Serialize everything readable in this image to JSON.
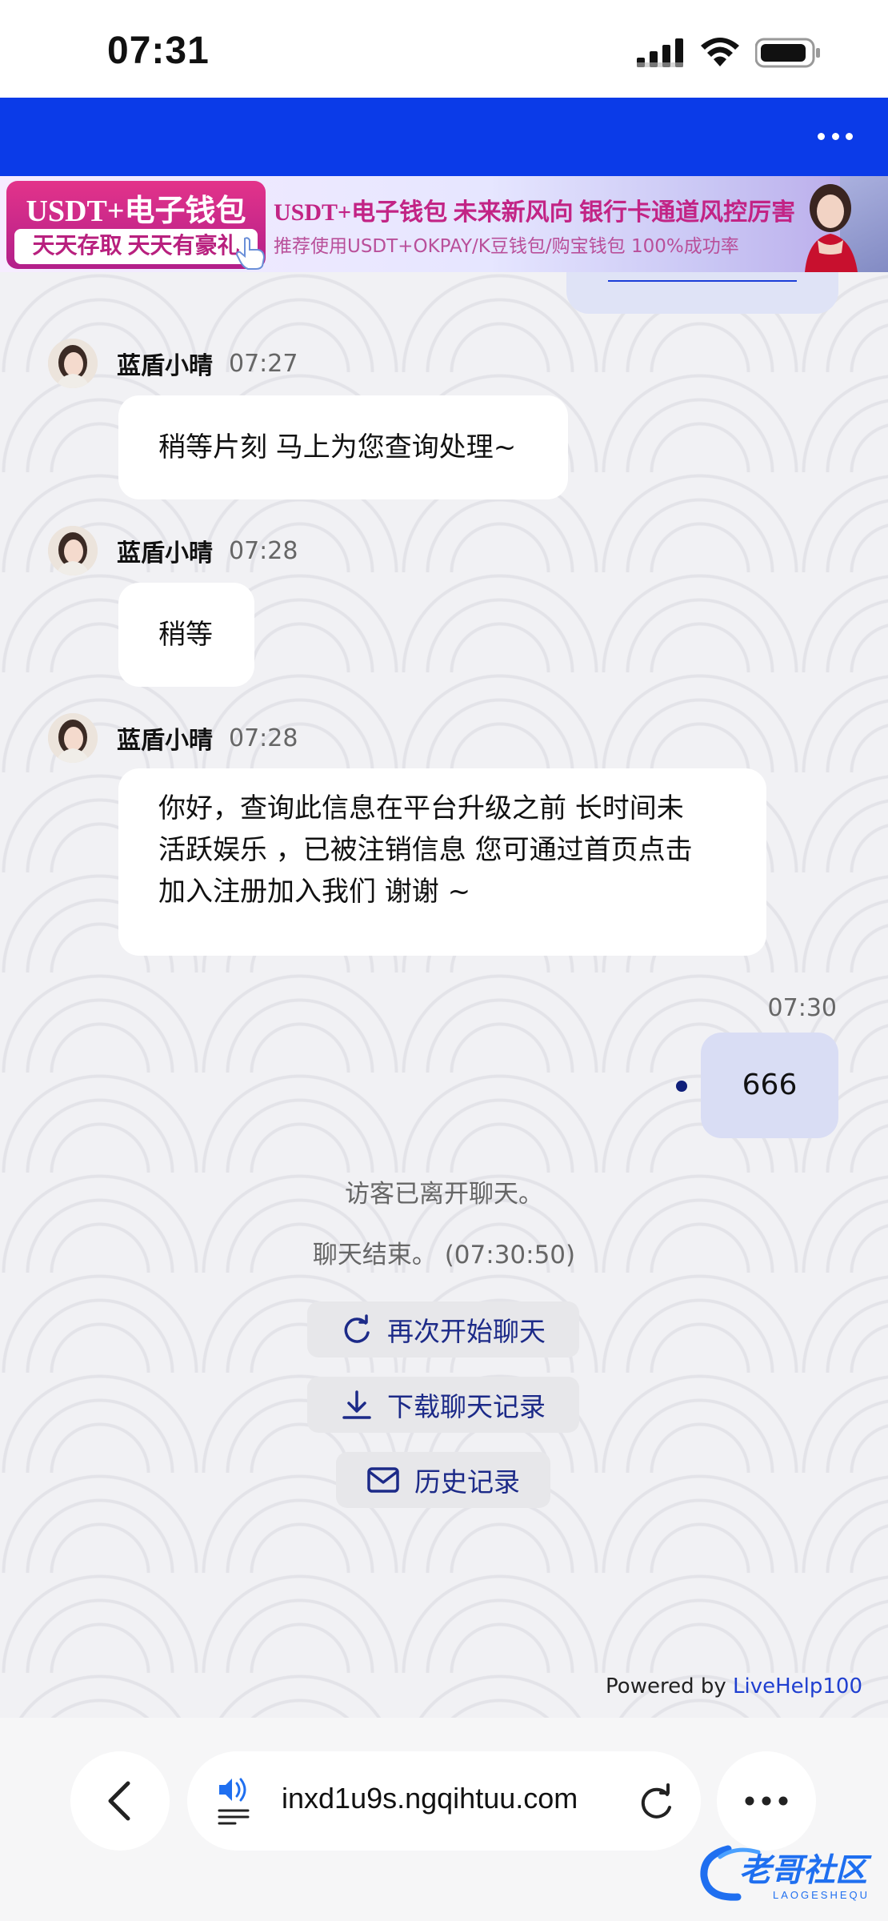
{
  "status_bar": {
    "time": "07:31"
  },
  "banner": {
    "left_title": "USDT+电子钱包",
    "left_sub": "天天存取 天天有豪礼",
    "main_text": "USDT+电子钱包  未来新风向  银行卡通道风控厉害",
    "sub_text": "推荐使用USDT+OKPAY/K豆钱包/购宝钱包   100%成功率"
  },
  "messages": [
    {
      "name": "蓝盾小晴",
      "time": "07:27",
      "text": "稍等片刻 马上为您查询处理~"
    },
    {
      "name": "蓝盾小晴",
      "time": "07:28",
      "text": "稍等"
    },
    {
      "name": "蓝盾小晴",
      "time": "07:28",
      "lines": [
        "你好，查询此信息在平台升级之前 长时间未",
        "活跃娱乐 ，已被注销信息 您可通过首页点击",
        "加入注册加入我们 谢谢 ~"
      ]
    }
  ],
  "visitor_message": {
    "time": "07:30",
    "text": "666"
  },
  "system": {
    "left": "访客已离开聊天。",
    "ended": "聊天结束。 (07:30:50)"
  },
  "actions": {
    "restart": "再次开始聊天",
    "download": "下载聊天记录",
    "history": "历史记录"
  },
  "powered": {
    "prefix": "Powered by ",
    "brand": "LiveHelp100"
  },
  "browser": {
    "url": "inxd1u9s.ngqihtuu.com"
  },
  "watermark": {
    "text": "老哥社区",
    "sub": "LAOGESHEQU"
  },
  "colors": {
    "topbar": "#0b3be8",
    "link": "#1f3fd0",
    "visitor_bubble": "#d9ddf4"
  }
}
